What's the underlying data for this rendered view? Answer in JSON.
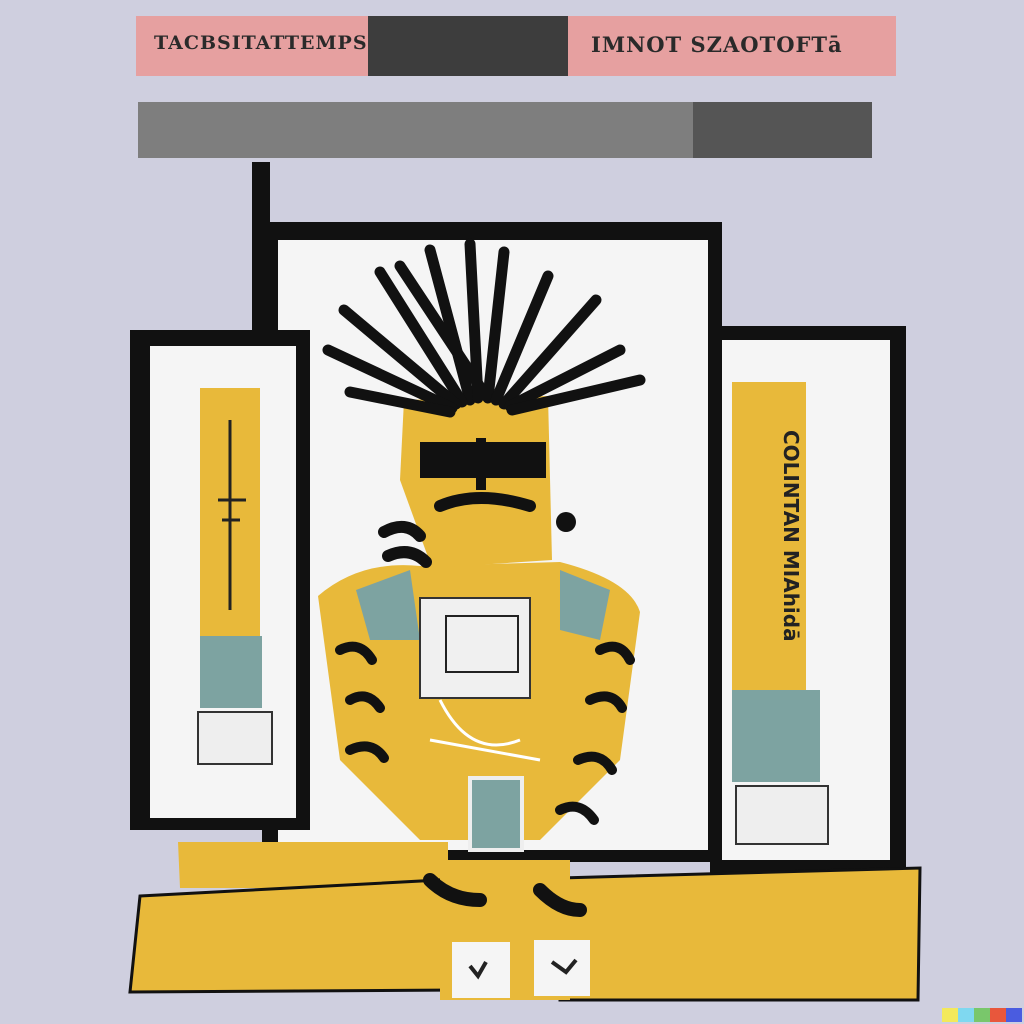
{
  "banner": {
    "left_text": "TACBSITATTEMPS",
    "right_text": "IMNOT SZAOTOFTā"
  },
  "side_panels": {
    "left_label": "",
    "right_label": "COLINTAN MIAhidā"
  },
  "colors": {
    "background": "#cfcfdf",
    "banner_pink": "#e6a0a0",
    "yellow": "#e8b93a",
    "teal": "#7da3a1",
    "ink": "#111111"
  },
  "corner_swatches": [
    "#f3e95b",
    "#7fd8f0",
    "#79c76b",
    "#e8573c",
    "#4a5ce0"
  ]
}
